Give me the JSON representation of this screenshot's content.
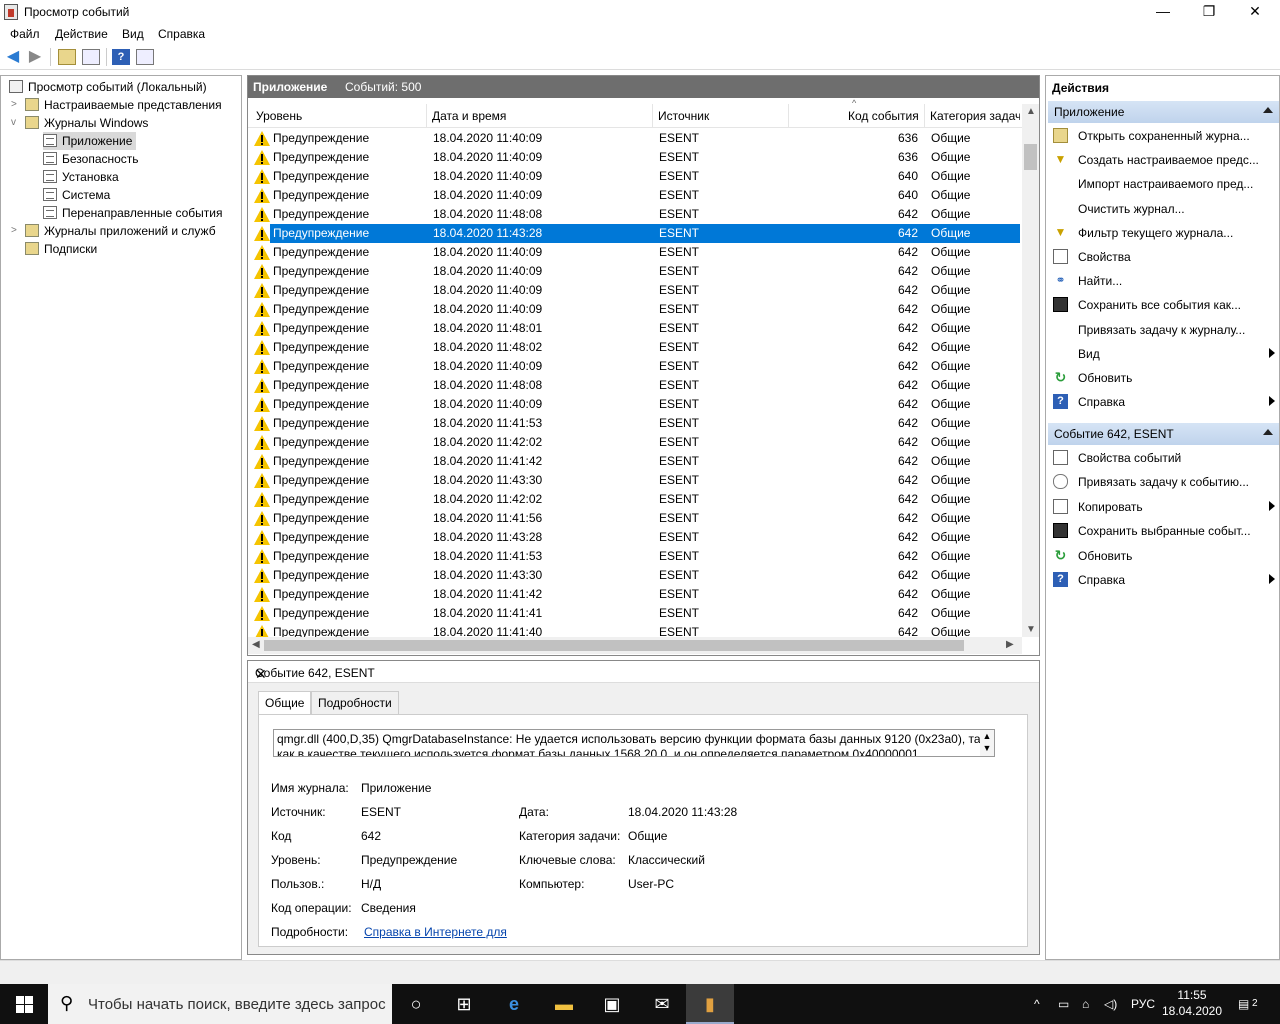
{
  "window": {
    "title": "Просмотр событий",
    "min": "—",
    "max": "❐",
    "close": "✕"
  },
  "menu": {
    "file": "Файл",
    "action": "Действие",
    "view": "Вид",
    "help": "Справка"
  },
  "tree": {
    "root": "Просмотр событий (Локальный)",
    "custom_views": "Настраиваемые представления",
    "windows_logs": "Журналы Windows",
    "application": "Приложение",
    "security": "Безопасность",
    "setup": "Установка",
    "system": "Система",
    "forwarded": "Перенаправленные события",
    "apps_services": "Журналы приложений и служб",
    "subscriptions": "Подписки"
  },
  "center": {
    "log_name": "Приложение",
    "count": "Событий: 500",
    "columns": {
      "level": "Уровень",
      "datetime": "Дата и время",
      "source": "Источник",
      "event_id": "Код события",
      "task": "Категория задач"
    },
    "rows": [
      {
        "level": "Предупреждение",
        "dt": "18.04.2020 11:40:09",
        "src": "ESENT",
        "id": "636",
        "task": "Общие"
      },
      {
        "level": "Предупреждение",
        "dt": "18.04.2020 11:40:09",
        "src": "ESENT",
        "id": "636",
        "task": "Общие"
      },
      {
        "level": "Предупреждение",
        "dt": "18.04.2020 11:40:09",
        "src": "ESENT",
        "id": "640",
        "task": "Общие"
      },
      {
        "level": "Предупреждение",
        "dt": "18.04.2020 11:40:09",
        "src": "ESENT",
        "id": "640",
        "task": "Общие"
      },
      {
        "level": "Предупреждение",
        "dt": "18.04.2020 11:48:08",
        "src": "ESENT",
        "id": "642",
        "task": "Общие"
      },
      {
        "level": "Предупреждение",
        "dt": "18.04.2020 11:43:28",
        "src": "ESENT",
        "id": "642",
        "task": "Общие"
      },
      {
        "level": "Предупреждение",
        "dt": "18.04.2020 11:40:09",
        "src": "ESENT",
        "id": "642",
        "task": "Общие"
      },
      {
        "level": "Предупреждение",
        "dt": "18.04.2020 11:40:09",
        "src": "ESENT",
        "id": "642",
        "task": "Общие"
      },
      {
        "level": "Предупреждение",
        "dt": "18.04.2020 11:40:09",
        "src": "ESENT",
        "id": "642",
        "task": "Общие"
      },
      {
        "level": "Предупреждение",
        "dt": "18.04.2020 11:40:09",
        "src": "ESENT",
        "id": "642",
        "task": "Общие"
      },
      {
        "level": "Предупреждение",
        "dt": "18.04.2020 11:48:01",
        "src": "ESENT",
        "id": "642",
        "task": "Общие"
      },
      {
        "level": "Предупреждение",
        "dt": "18.04.2020 11:48:02",
        "src": "ESENT",
        "id": "642",
        "task": "Общие"
      },
      {
        "level": "Предупреждение",
        "dt": "18.04.2020 11:40:09",
        "src": "ESENT",
        "id": "642",
        "task": "Общие"
      },
      {
        "level": "Предупреждение",
        "dt": "18.04.2020 11:48:08",
        "src": "ESENT",
        "id": "642",
        "task": "Общие"
      },
      {
        "level": "Предупреждение",
        "dt": "18.04.2020 11:40:09",
        "src": "ESENT",
        "id": "642",
        "task": "Общие"
      },
      {
        "level": "Предупреждение",
        "dt": "18.04.2020 11:41:53",
        "src": "ESENT",
        "id": "642",
        "task": "Общие"
      },
      {
        "level": "Предупреждение",
        "dt": "18.04.2020 11:42:02",
        "src": "ESENT",
        "id": "642",
        "task": "Общие"
      },
      {
        "level": "Предупреждение",
        "dt": "18.04.2020 11:41:42",
        "src": "ESENT",
        "id": "642",
        "task": "Общие"
      },
      {
        "level": "Предупреждение",
        "dt": "18.04.2020 11:43:30",
        "src": "ESENT",
        "id": "642",
        "task": "Общие"
      },
      {
        "level": "Предупреждение",
        "dt": "18.04.2020 11:42:02",
        "src": "ESENT",
        "id": "642",
        "task": "Общие"
      },
      {
        "level": "Предупреждение",
        "dt": "18.04.2020 11:41:56",
        "src": "ESENT",
        "id": "642",
        "task": "Общие"
      },
      {
        "level": "Предупреждение",
        "dt": "18.04.2020 11:43:28",
        "src": "ESENT",
        "id": "642",
        "task": "Общие"
      },
      {
        "level": "Предупреждение",
        "dt": "18.04.2020 11:41:53",
        "src": "ESENT",
        "id": "642",
        "task": "Общие"
      },
      {
        "level": "Предупреждение",
        "dt": "18.04.2020 11:43:30",
        "src": "ESENT",
        "id": "642",
        "task": "Общие"
      },
      {
        "level": "Предупреждение",
        "dt": "18.04.2020 11:41:42",
        "src": "ESENT",
        "id": "642",
        "task": "Общие"
      },
      {
        "level": "Предупреждение",
        "dt": "18.04.2020 11:41:41",
        "src": "ESENT",
        "id": "642",
        "task": "Общие"
      },
      {
        "level": "Предупреждение",
        "dt": "18.04.2020 11:41:40",
        "src": "ESENT",
        "id": "642",
        "task": "Общие"
      }
    ],
    "selected_index": 5
  },
  "detail": {
    "title": "Событие 642, ESENT",
    "tab_general": "Общие",
    "tab_details": "Подробности",
    "description": "qmgr.dll (400,D,35) QmgrDatabaseInstance: Не удается использовать версию функции формата базы данных 9120 (0x23a0), так как в качестве текущего используется формат базы данных 1568.20.0, и он определяется параметром 0x40000001",
    "lbl_log": "Имя журнала:",
    "val_log": "Приложение",
    "lbl_source": "Источник:",
    "val_source": "ESENT",
    "lbl_date": "Дата:",
    "val_date": "18.04.2020 11:43:28",
    "lbl_code": "Код",
    "val_code": "642",
    "lbl_task": "Категория задачи:",
    "val_task": "Общие",
    "lbl_level": "Уровень:",
    "val_level": "Предупреждение",
    "lbl_keywords": "Ключевые слова:",
    "val_keywords": "Классический",
    "lbl_user": "Пользов.:",
    "val_user": "Н/Д",
    "lbl_computer": "Компьютер:",
    "val_computer": "User-PC",
    "lbl_opcode": "Код операции:",
    "val_opcode": "Сведения",
    "lbl_more": "Подробности:",
    "val_more": "Справка в Интернете для "
  },
  "actions": {
    "header": "Действия",
    "section1": "Приложение",
    "items1": [
      {
        "label": "Открыть сохраненный журна...",
        "icon": "folder",
        "sub": false
      },
      {
        "label": "Создать настраиваемое предс...",
        "icon": "filt",
        "sub": false
      },
      {
        "label": "Импорт настраиваемого пред...",
        "icon": "",
        "sub": false
      },
      {
        "label": "Очистить журнал...",
        "icon": "",
        "sub": false
      },
      {
        "label": "Фильтр текущего журнала...",
        "icon": "filt",
        "sub": false
      },
      {
        "label": "Свойства",
        "icon": "doc",
        "sub": false
      },
      {
        "label": "Найти...",
        "icon": "find",
        "sub": false
      },
      {
        "label": "Сохранить все события как...",
        "icon": "disk",
        "sub": false
      },
      {
        "label": "Привязать задачу к журналу...",
        "icon": "",
        "sub": false
      },
      {
        "label": "Вид",
        "icon": "",
        "sub": true
      },
      {
        "label": "Обновить",
        "icon": "ref",
        "sub": false
      },
      {
        "label": "Справка",
        "icon": "help",
        "sub": true
      }
    ],
    "section2": "Событие 642, ESENT",
    "items2": [
      {
        "label": "Свойства событий",
        "icon": "doc",
        "sub": false
      },
      {
        "label": "Привязать задачу к событию...",
        "icon": "clock",
        "sub": false
      },
      {
        "label": "Копировать",
        "icon": "doc",
        "sub": true
      },
      {
        "label": "Сохранить выбранные событ...",
        "icon": "disk",
        "sub": false
      },
      {
        "label": "Обновить",
        "icon": "ref",
        "sub": false
      },
      {
        "label": "Справка",
        "icon": "help",
        "sub": true
      }
    ]
  },
  "taskbar": {
    "search_placeholder": "Чтобы начать поиск, введите здесь запрос",
    "lang": "РУС",
    "time": "11:55",
    "date": "18.04.2020",
    "notif_count": "2"
  }
}
